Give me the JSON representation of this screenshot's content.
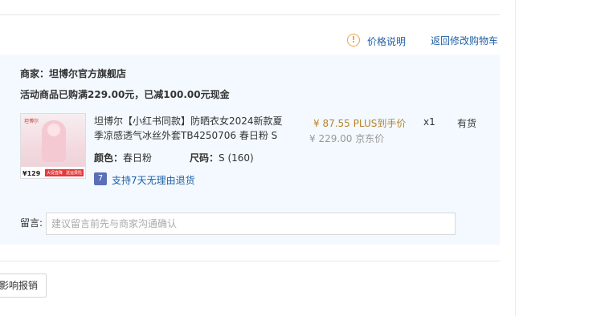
{
  "links": {
    "price_explain": "价格说明",
    "back_to_cart": "返回修改购物车"
  },
  "shop": {
    "label": "商家：坦博尔官方旗舰店"
  },
  "promotion": {
    "text": "活动商品已购满229.00元，已减100.00元现金"
  },
  "product": {
    "thumbnail_brand": "坦博尔",
    "thumbnail_price": "129",
    "thumbnail_badge1": "大促直降",
    "thumbnail_badge2": "送运费险",
    "title_line1": "坦博尔【小红书同款】防晒衣女2024新款夏",
    "title_line2": "季凉感透气冰丝外套TB4250706 春日粉 S",
    "color_key": "颜色：",
    "color_value": "春日粉",
    "size_key": "尺码：",
    "size_value": "S (160)",
    "return_icon": "7",
    "return_text": "支持7天无理由退货",
    "plus_price": "¥ 87.55 PLUS到手价",
    "jd_price": "¥ 229.00 京东价",
    "quantity": "x1",
    "stock": "有货"
  },
  "message": {
    "label": "留言:",
    "placeholder": "建议留言前先与商家沟通确认"
  },
  "footer": {
    "partial_button": "影响报销"
  },
  "colors": {
    "panel_bg": "#f3f9fe",
    "link_blue": "#1f5fa6",
    "plus_price": "#b7822b",
    "warn": "#f0a23b"
  }
}
